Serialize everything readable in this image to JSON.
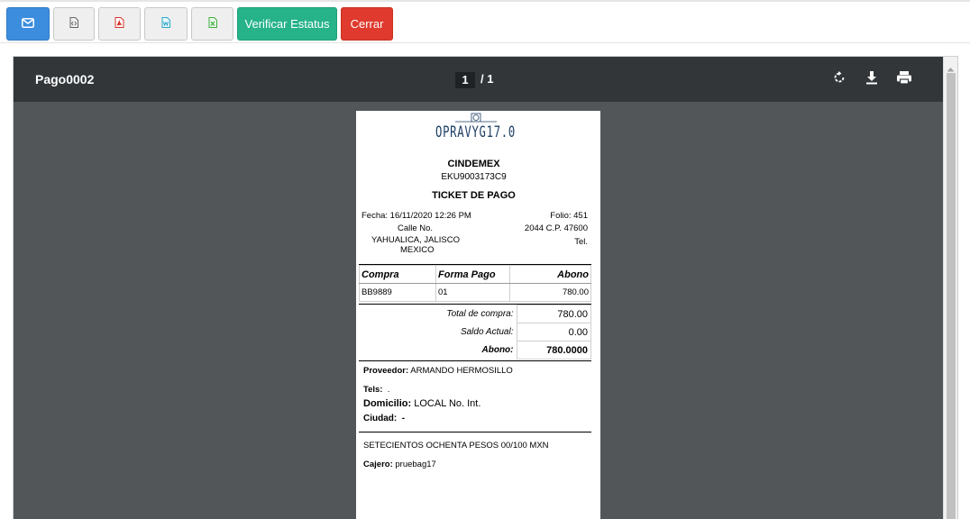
{
  "toolbar": {
    "email_icon": "envelope-icon",
    "xml_icon": "code-file-icon",
    "pdf_icon": "pdf-file-icon",
    "doc_icon": "word-file-icon",
    "xls_icon": "excel-file-icon",
    "verify_label": "Verificar Estatus",
    "close_label": "Cerrar"
  },
  "viewer": {
    "title": "Pago0002",
    "current_page": "1",
    "page_total": "/  1",
    "rotate_icon": "rotate-icon",
    "download_icon": "download-icon",
    "print_icon": "print-icon"
  },
  "ticket": {
    "logo_text": "OPRAVYG17.0",
    "company": "CINDEMEX",
    "rfc": "EKU9003173C9",
    "doc_title": "TICKET DE PAGO",
    "fecha": "Fecha: 16/11/2020 12:26 PM",
    "folio": "Folio: 451",
    "calle": "Calle No.",
    "cp": "2044 C.P. 47600",
    "city": "YAHUALICA, JALISCO",
    "tel": "Tel.",
    "country": "MEXICO",
    "columns": [
      "Compra",
      "Forma Pago",
      "Abono"
    ],
    "rows": [
      [
        "BB9889",
        "01",
        "780.00"
      ]
    ],
    "total_compra_label": "Total de compra:",
    "total_compra": "780.00",
    "saldo_label": "Saldo Actual:",
    "saldo": "0.00",
    "abono_label": "Abono:",
    "abono": "780.0000",
    "proveedor_label": "Proveedor:",
    "proveedor": "ARMANDO HERMOSILLO",
    "tels_label": "Tels:",
    "tels": ".",
    "domicilio_label": "Domicilio:",
    "domicilio": "LOCAL No.  Int.",
    "ciudad_label": "Ciudad:",
    "ciudad": "-",
    "amount_words": "SETECIENTOS OCHENTA PESOS 00/100 MXN",
    "cajero_label": "Cajero:",
    "cajero": "pruebag17"
  }
}
